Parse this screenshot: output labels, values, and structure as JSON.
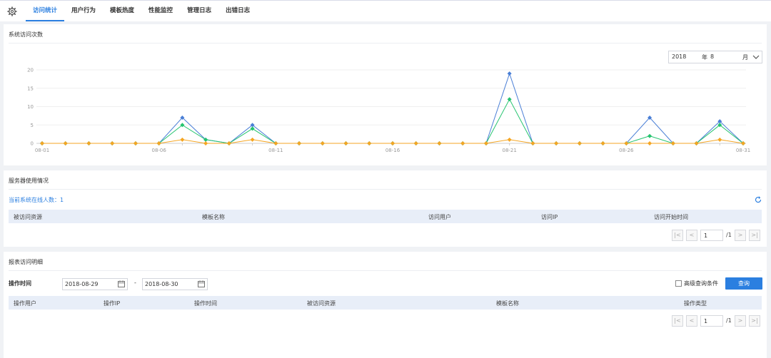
{
  "nav": {
    "tabs": [
      "访问统计",
      "用户行为",
      "模板热度",
      "性能监控",
      "管理日志",
      "出错日志"
    ],
    "active_tab": 0
  },
  "visits": {
    "title": "系统访问次数",
    "year_value": "2018",
    "year_unit": "年",
    "month_value": "8",
    "month_unit": "月",
    "chart_data": {
      "type": "line",
      "x": [
        "08-01",
        "08-02",
        "08-03",
        "08-04",
        "08-05",
        "08-06",
        "08-07",
        "08-08",
        "08-09",
        "08-10",
        "08-11",
        "08-12",
        "08-13",
        "08-14",
        "08-15",
        "08-16",
        "08-17",
        "08-18",
        "08-19",
        "08-20",
        "08-21",
        "08-22",
        "08-23",
        "08-24",
        "08-25",
        "08-26",
        "08-27",
        "08-28",
        "08-29",
        "08-30",
        "08-31"
      ],
      "xtick_labels": [
        "08-01",
        "08-06",
        "08-11",
        "08-16",
        "08-21",
        "08-26",
        "08-31"
      ],
      "ylim": [
        0,
        20
      ],
      "yticks": [
        0,
        5,
        10,
        15,
        20
      ],
      "grid": true,
      "series": [
        {
          "color": "#4a7fd6",
          "values": [
            0,
            0,
            0,
            0,
            0,
            0,
            7,
            1,
            0,
            5,
            0,
            0,
            0,
            0,
            0,
            0,
            0,
            0,
            0,
            0,
            19,
            0,
            0,
            0,
            0,
            0,
            7,
            0,
            0,
            6,
            0
          ]
        },
        {
          "color": "#25c46f",
          "values": [
            0,
            0,
            0,
            0,
            0,
            0,
            5,
            1,
            0,
            4,
            0,
            0,
            0,
            0,
            0,
            0,
            0,
            0,
            0,
            0,
            12,
            0,
            0,
            0,
            0,
            0,
            2,
            0,
            0,
            5,
            0
          ]
        },
        {
          "color": "#f5a623",
          "values": [
            0,
            0,
            0,
            0,
            0,
            0,
            1,
            0,
            0,
            1,
            0,
            0,
            0,
            0,
            0,
            0,
            0,
            0,
            0,
            0,
            1,
            0,
            0,
            0,
            0,
            0,
            0,
            0,
            0,
            1,
            0
          ]
        }
      ]
    }
  },
  "server": {
    "title": "服务器使用情况",
    "online_label": "当前系统在线人数：",
    "online_count": "1",
    "columns": [
      "被访问资源",
      "模板名称",
      "访问用户",
      "访问IP",
      "访问开始时间"
    ],
    "page": "1",
    "total": "/1"
  },
  "report": {
    "title": "报表访问明细",
    "op_time_label": "操作时间",
    "date_from": "2018-08-29",
    "date_sep": "-",
    "date_to": "2018-08-30",
    "advanced_label": "高级查询条件",
    "query_button": "查询",
    "columns": [
      "操作用户",
      "操作IP",
      "操作时间",
      "被访问资源",
      "模板名称",
      "操作类型"
    ],
    "page": "1",
    "total": "/1"
  }
}
